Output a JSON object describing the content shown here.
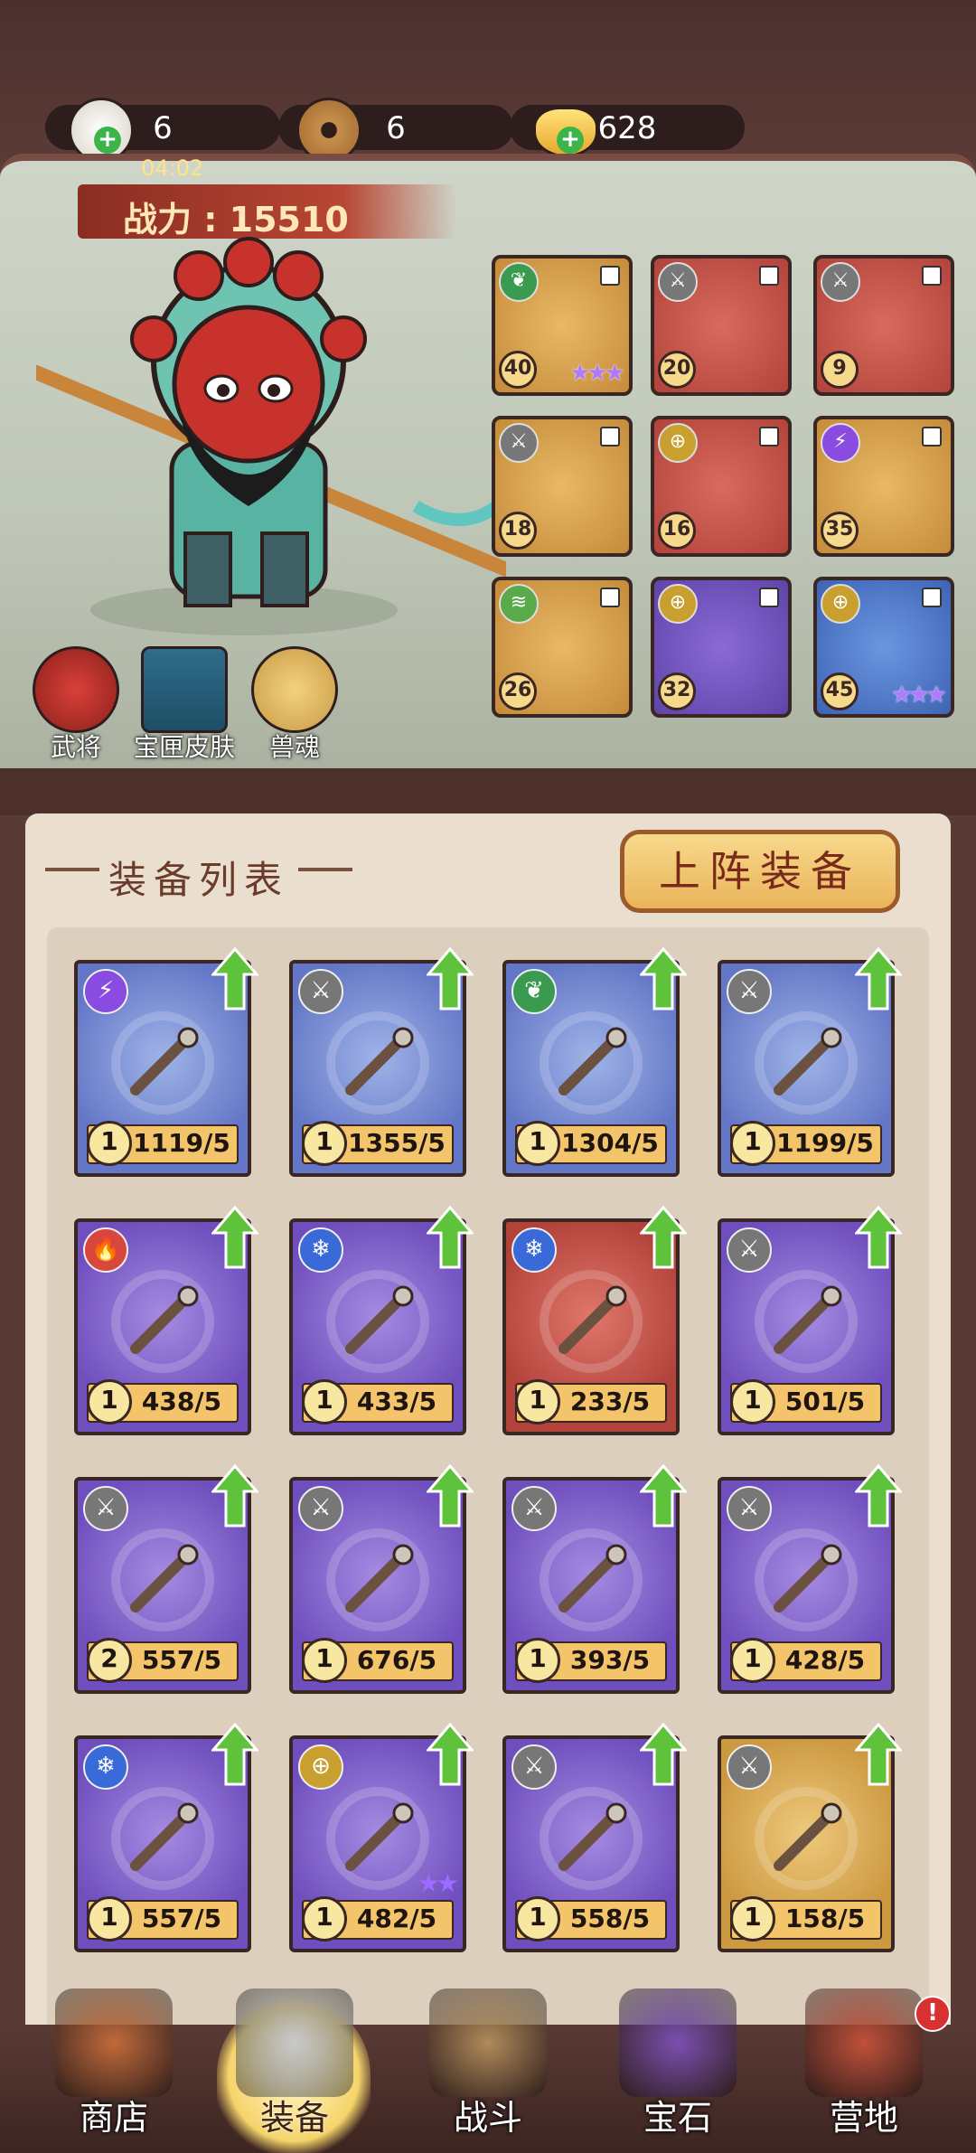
{
  "resources": [
    {
      "name": "bun",
      "value": "6",
      "icon": "bun-icon"
    },
    {
      "name": "coin",
      "value": "6",
      "icon": "copper-coin-icon"
    },
    {
      "name": "ingot",
      "value": "628",
      "icon": "gold-ingot-icon"
    }
  ],
  "timer": "04:02",
  "combat_power": {
    "label": "战力",
    "value": "15510",
    "text": "战力 : 15510"
  },
  "side_nav": [
    {
      "label": "武将",
      "icon": "general-icon"
    },
    {
      "label": "宝匣皮肤",
      "icon": "treasure-box-skin-icon"
    },
    {
      "label": "兽魂",
      "icon": "beast-soul-icon"
    }
  ],
  "equipped": [
    {
      "level": "40",
      "bg": "gold",
      "type": "nature",
      "stars": 3
    },
    {
      "level": "20",
      "bg": "red",
      "type": "sword",
      "stars": 0
    },
    {
      "level": "9",
      "bg": "red",
      "type": "sword",
      "stars": 0
    },
    {
      "level": "18",
      "bg": "gold",
      "type": "sword",
      "stars": 0
    },
    {
      "level": "16",
      "bg": "red",
      "type": "target",
      "stars": 0
    },
    {
      "level": "35",
      "bg": "gold",
      "type": "lightning",
      "stars": 0
    },
    {
      "level": "26",
      "bg": "gold",
      "type": "wind",
      "stars": 0
    },
    {
      "level": "32",
      "bg": "purple",
      "type": "target",
      "stars": 0
    },
    {
      "level": "45",
      "bg": "blue",
      "type": "target",
      "stars": 3
    }
  ],
  "list_title": "装备列表",
  "deploy_button": "上阵装备",
  "equipment_list": [
    {
      "count": "1",
      "progress": "1119/5",
      "bg": "blue",
      "type": "lightning",
      "item": "whip"
    },
    {
      "count": "1",
      "progress": "1355/5",
      "bg": "blue",
      "type": "sword",
      "item": "sword"
    },
    {
      "count": "1",
      "progress": "1304/5",
      "bg": "blue",
      "type": "nature",
      "item": "gourd-bottle"
    },
    {
      "count": "1",
      "progress": "1199/5",
      "bg": "blue",
      "type": "sword",
      "item": "saber"
    },
    {
      "count": "1",
      "progress": "438/5",
      "bg": "purple",
      "type": "fire",
      "item": "wheel"
    },
    {
      "count": "1",
      "progress": "433/5",
      "bg": "purple",
      "type": "ice",
      "item": "pendant"
    },
    {
      "count": "1",
      "progress": "233/5",
      "bg": "red",
      "type": "ice",
      "item": "cauldron"
    },
    {
      "count": "1",
      "progress": "501/5",
      "bg": "purple",
      "type": "sword",
      "item": "spear"
    },
    {
      "count": "2",
      "progress": "557/5",
      "bg": "purple",
      "type": "sword",
      "item": "caltrops"
    },
    {
      "count": "1",
      "progress": "676/5",
      "bg": "purple",
      "type": "sword",
      "item": "crossbow"
    },
    {
      "count": "1",
      "progress": "393/5",
      "bg": "purple",
      "type": "sword",
      "item": "boomerang"
    },
    {
      "count": "1",
      "progress": "428/5",
      "bg": "purple",
      "type": "sword",
      "item": "bow"
    },
    {
      "count": "1",
      "progress": "557/5",
      "bg": "purple",
      "type": "ice",
      "item": "hook"
    },
    {
      "count": "1",
      "progress": "482/5",
      "bg": "purple",
      "type": "target",
      "item": "gourd",
      "stars": 2
    },
    {
      "count": "1",
      "progress": "558/5",
      "bg": "purple",
      "type": "sword",
      "item": "pearl"
    },
    {
      "count": "1",
      "progress": "158/5",
      "bg": "gold",
      "type": "sword",
      "item": "hammer"
    }
  ],
  "tabs": [
    {
      "label": "商店",
      "icon": "shop-icon"
    },
    {
      "label": "装备",
      "icon": "equipment-icon",
      "active": true
    },
    {
      "label": "战斗",
      "icon": "battle-icon"
    },
    {
      "label": "宝石",
      "icon": "gem-chest-icon"
    },
    {
      "label": "营地",
      "icon": "camp-icon",
      "badge": "!"
    }
  ],
  "colors": {
    "accent": "#f3c46a",
    "panel": "#eadfcf",
    "frame": "#5a3a35",
    "upgrade": "#5fc23b"
  }
}
